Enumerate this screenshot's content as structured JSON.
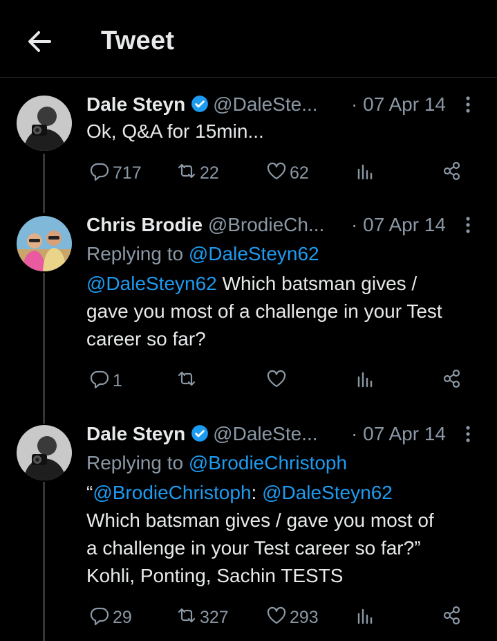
{
  "header": {
    "title": "Tweet"
  },
  "tweets": [
    {
      "name": "Dale Steyn",
      "handle": "@DaleSte...",
      "time": "· 07 Apr 14",
      "verified": true,
      "text_lines": [
        "Ok, Q&A for 15min..."
      ],
      "replies": "717",
      "retweets": "22",
      "likes": "62"
    },
    {
      "name": "Chris Brodie",
      "handle": "@BrodieCh...",
      "time": "· 07 Apr 14",
      "verified": false,
      "reply_label": "Replying to",
      "reply_to": "@DaleSteyn62",
      "mention": "@DaleSteyn62",
      "text_after_mention": " Which batsman gives /",
      "text_lines": [
        "gave you most of a challenge in your Test",
        "career so far?"
      ],
      "replies": "1",
      "retweets": "",
      "likes": ""
    },
    {
      "name": "Dale Steyn",
      "handle": "@DaleSte...",
      "time": "· 07 Apr 14",
      "verified": true,
      "reply_label": "Replying to",
      "reply_to": "@BrodieChristoph",
      "quote_open": "“",
      "mention1": "@BrodieChristoph",
      "colon": ": ",
      "mention2": "@DaleSteyn62",
      "text_lines": [
        "Which batsman gives / gave you most of",
        "a challenge in your Test career so far?”",
        "Kohli, Ponting, Sachin TESTS"
      ],
      "replies": "29",
      "retweets": "327",
      "likes": "293"
    }
  ],
  "icons": {
    "back": "arrow-left-icon",
    "verified": "verified-badge-icon",
    "more": "more-vertical-icon",
    "reply": "reply-icon",
    "retweet": "retweet-icon",
    "like": "heart-icon",
    "views": "views-chart-icon",
    "share": "share-icon"
  },
  "colors": {
    "background": "#000000",
    "text": "#e7e9ea",
    "muted": "#8b98a5",
    "accent": "#1d9bf0"
  }
}
